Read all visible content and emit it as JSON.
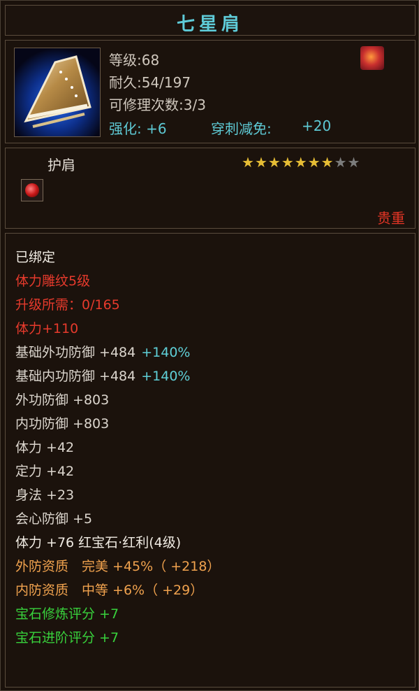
{
  "item": {
    "name": "七星肩",
    "level_line": "等级:68",
    "durability_line": "耐久:54/197",
    "repair_line": "可修理次数:3/3",
    "enhance_line": "强化: +6",
    "pierce_label": "穿刺减免:",
    "pierce_value": "+20",
    "slot_type": "护肩",
    "stars_filled": 7,
    "stars_total": 9,
    "rarity": "贵重"
  },
  "attributes": {
    "bound": "已绑定",
    "engraving": "体力雕纹5级",
    "upgrade_req": "升级所需：0/165",
    "engrave_bonus": "体力+110",
    "base_ext_def": "基础外功防御 +484",
    "base_ext_def_pct": "+140%",
    "base_int_def": "基础内功防御 +484",
    "base_int_def_pct": "+140%",
    "ext_def": "外功防御 +803",
    "int_def": "内功防御 +803",
    "stamina": "体力 +42",
    "focus": "定力 +42",
    "agility": "身法 +23",
    "crit_def": "会心防御 +5",
    "gem_stat": "体力 +76 红宝石·红利(4级)",
    "ext_quality": "外防资质　完美 +45%（ +218）",
    "int_quality": "内防资质　中等 +6%（ +29）",
    "gem_refine": "宝石修炼评分 +7",
    "gem_advance": "宝石进阶评分 +7"
  },
  "colors": {
    "title": "#5ecbd8",
    "star_on": "#e6bd35",
    "star_off": "#7c7c7c",
    "rarity": "#e23525",
    "green": "#38d13c",
    "orange": "#f0a24e"
  }
}
